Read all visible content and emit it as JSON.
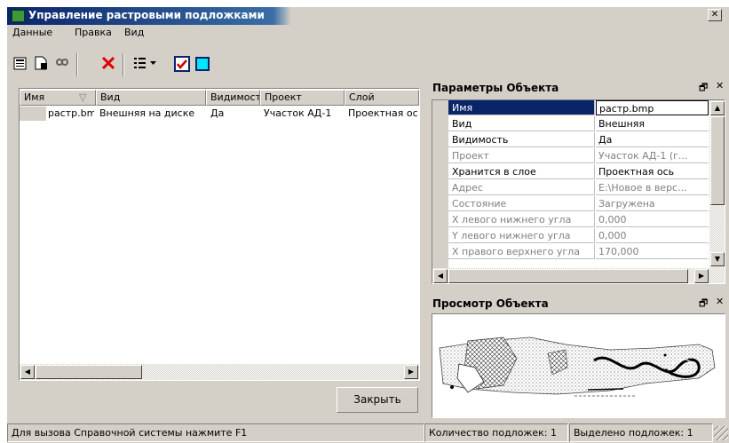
{
  "window": {
    "title": "Управление растровыми подложками",
    "close_symbol": "✕"
  },
  "menu": [
    "Данные",
    "Правка",
    "Вид"
  ],
  "toolbar": {
    "buttons": [
      "properties-icon",
      "new-document-icon",
      "find-icon",
      "delete-icon",
      "list-view-icon",
      "checkbox-icon",
      "color-box-icon"
    ],
    "delete_color": "#e00000",
    "check_color": "#d00000"
  },
  "table": {
    "columns": [
      "Имя",
      "Вид",
      "Видимость",
      "Проект",
      "Слой"
    ],
    "rows": [
      {
        "name": "растр.bmp",
        "vid": "Внешняя на диске",
        "visible": "Да",
        "project": "Участок АД-1",
        "layer": "Проектная ось"
      }
    ]
  },
  "properties_panel": {
    "title": "Параметры Объекта",
    "rows": [
      {
        "name": "Имя",
        "value": "растр.bmp"
      },
      {
        "name": "Вид",
        "value": "Внешняя"
      },
      {
        "name": "Видимость",
        "value": "Да"
      },
      {
        "name": "Проект",
        "value": "Участок АД-1 (г..."
      },
      {
        "name": "Хранится в слое",
        "value": "Проектная ось"
      },
      {
        "name": "Адрес",
        "value": "E:\\Новое в верс..."
      },
      {
        "name": "Состояние",
        "value": "Загружена"
      },
      {
        "name": "X левого нижнего угла",
        "value": "0,000"
      },
      {
        "name": "Y левого нижнего угла",
        "value": "0,000"
      },
      {
        "name": "X правого верхнего угла",
        "value": "170,000"
      }
    ]
  },
  "preview_panel": {
    "title": "Просмотр Объекта"
  },
  "panel_controls": {
    "float": "🗗",
    "close": "✕"
  },
  "close_button": "Закрыть",
  "statusbar": {
    "help": "Для вызова Справочной системы нажмите F1",
    "count": "Количество подложек: 1",
    "selected": "Выделено подложек: 1"
  }
}
